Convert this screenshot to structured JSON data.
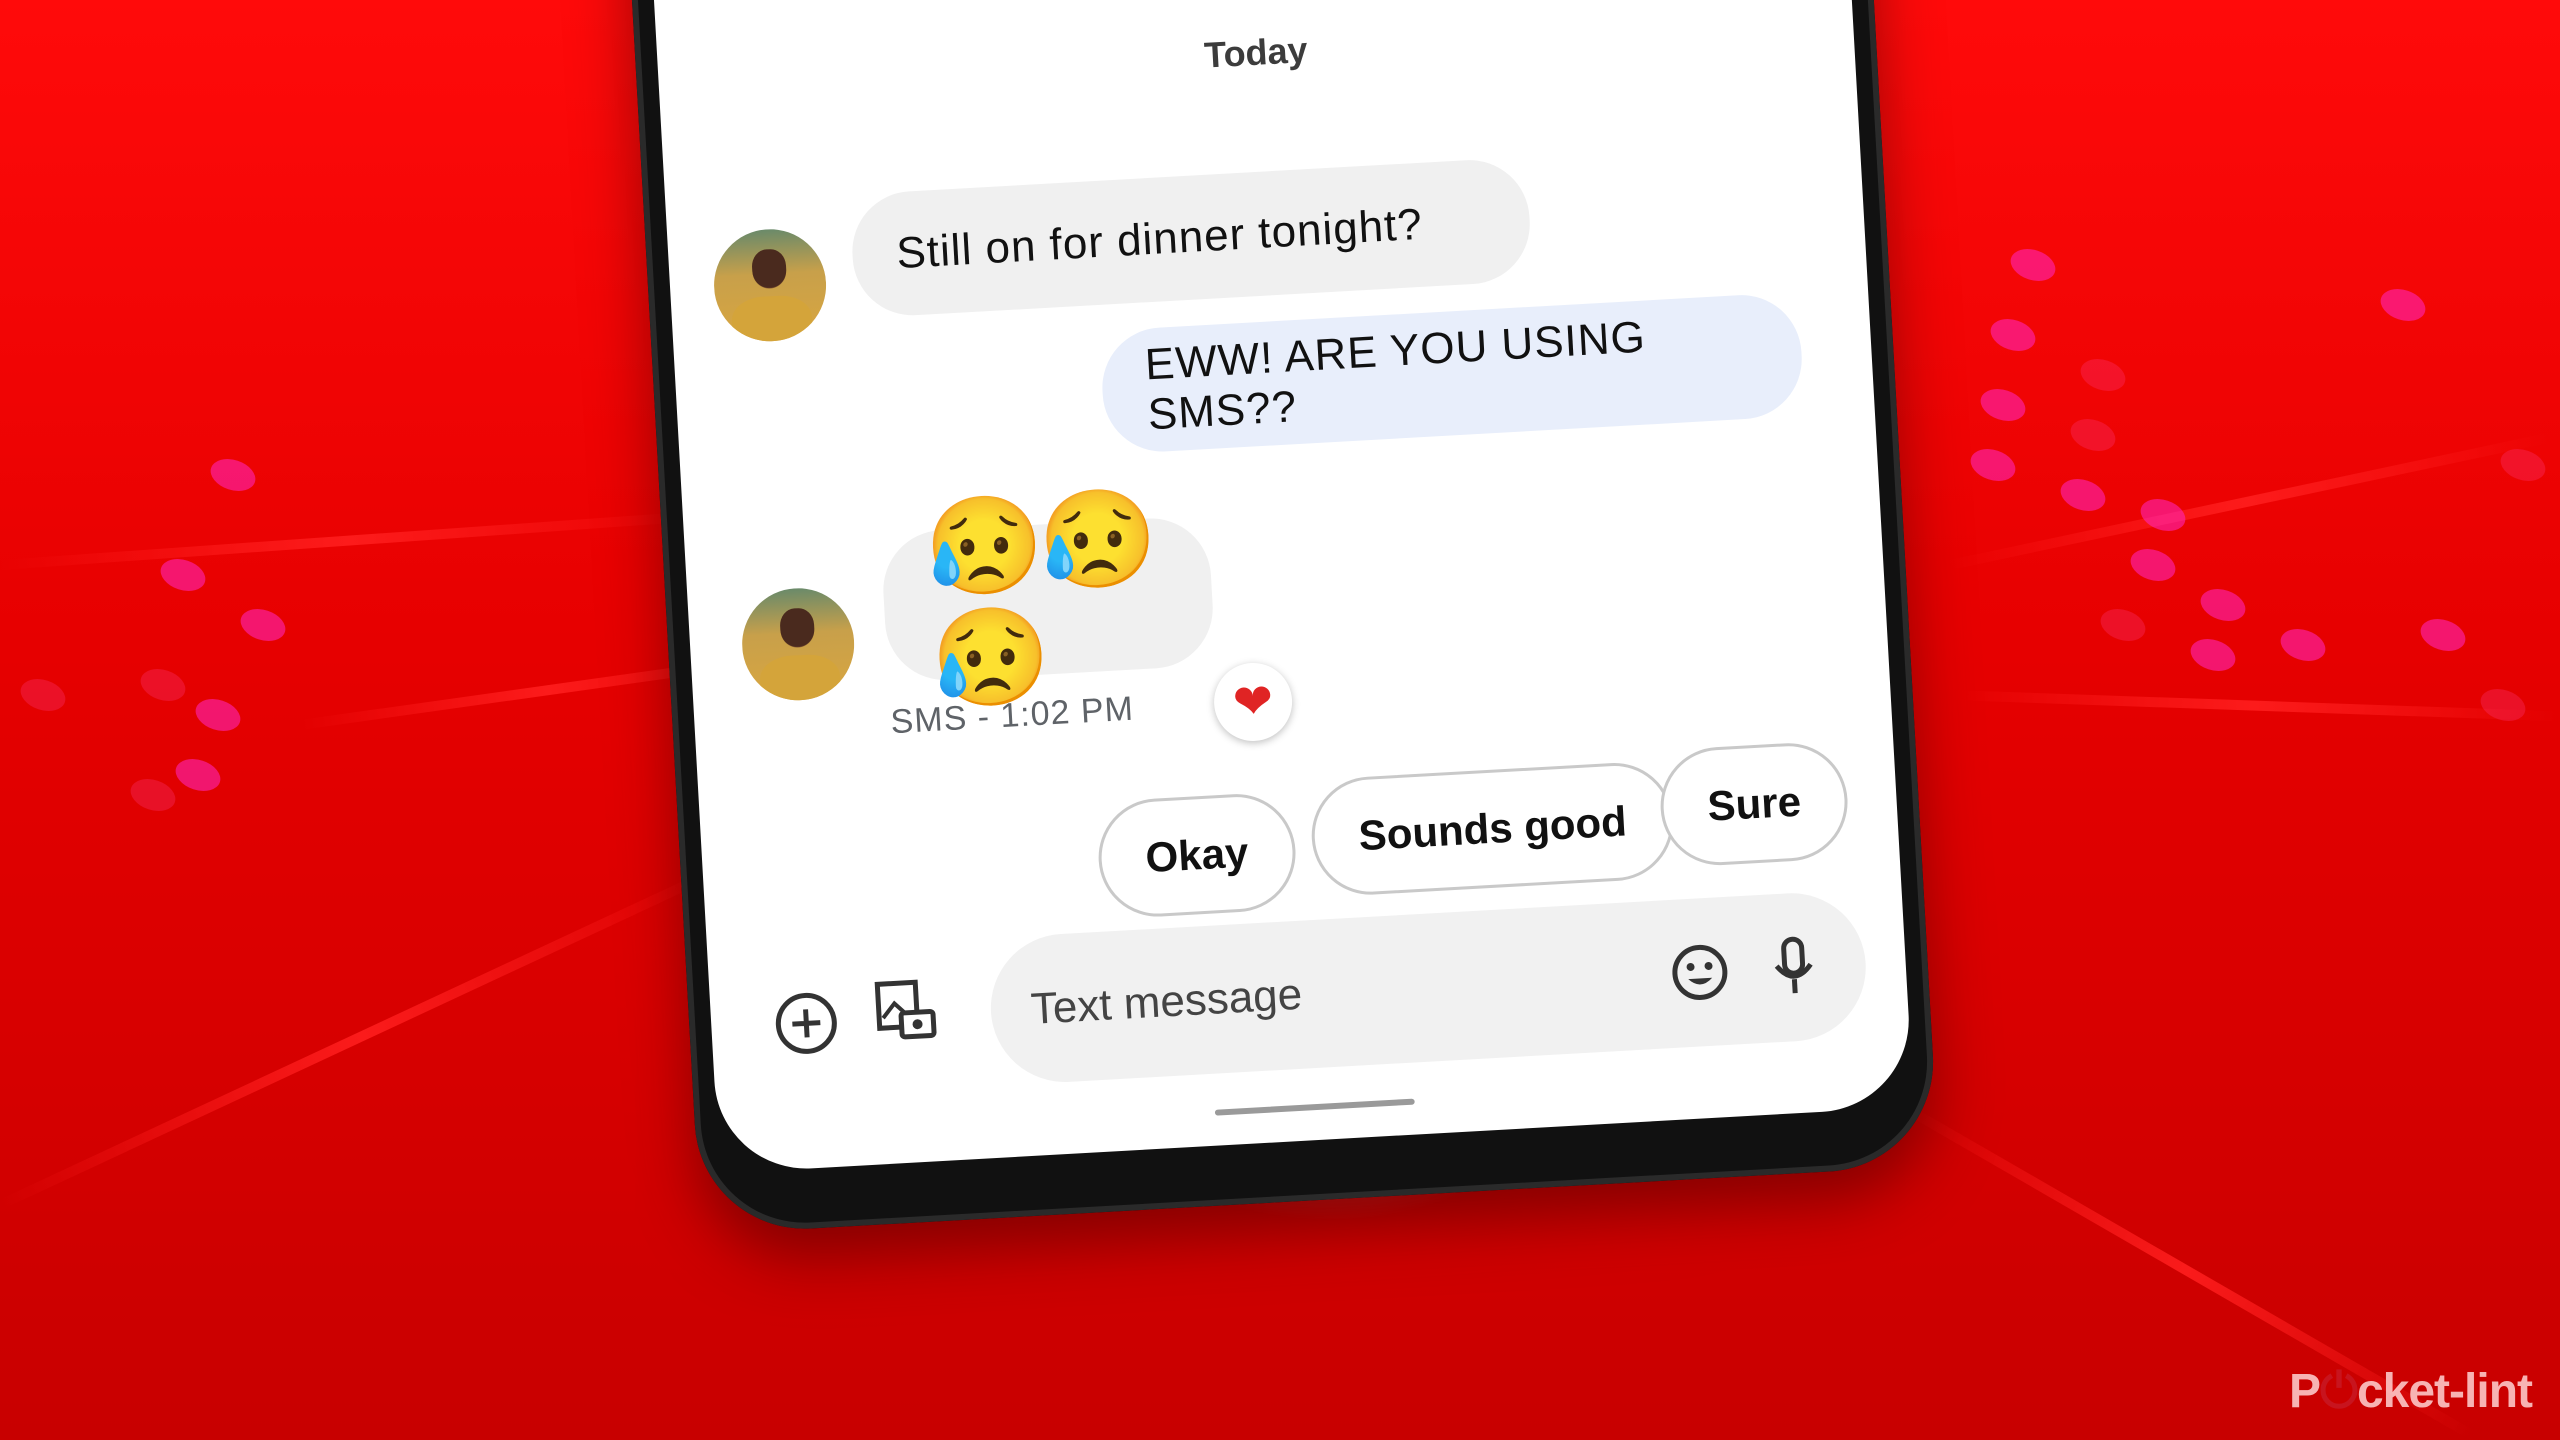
{
  "conversation": {
    "date_divider": "Today",
    "messages": [
      {
        "direction": "incoming",
        "text": "Still on for dinner tonight?"
      },
      {
        "direction": "outgoing",
        "text": "EWW! ARE YOU USING SMS??"
      },
      {
        "direction": "incoming",
        "text": "😥😥😥",
        "meta": "SMS - 1:02 PM",
        "reaction": "❤"
      }
    ]
  },
  "smart_replies": [
    "Okay",
    "Sounds good",
    "Sure"
  ],
  "composer": {
    "placeholder": "Text message",
    "icons": [
      "add-circle-icon",
      "gallery-camera-icon",
      "emoji-icon",
      "microphone-icon"
    ]
  },
  "watermark": {
    "prefix": "P",
    "power_glyph": "⏻",
    "suffix": "cket-lint"
  },
  "colors": {
    "background_red": "#e00000",
    "incoming_bubble": "#f0f0f0",
    "outgoing_bubble": "#e8eefb",
    "reaction_heart": "#e02424"
  }
}
